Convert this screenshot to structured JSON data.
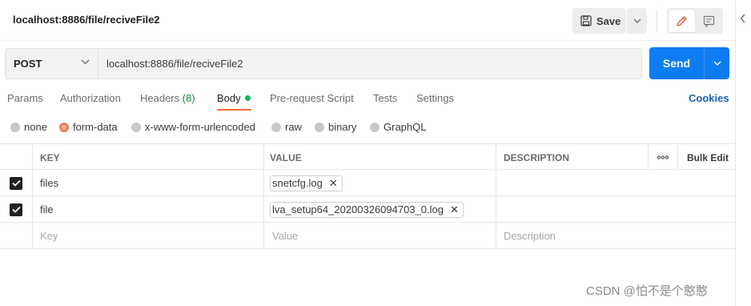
{
  "title_bar": {
    "request_title": "localhost:8886/file/reciveFile2",
    "save_label": "Save"
  },
  "url_bar": {
    "method": "POST",
    "url": "localhost:8886/file/reciveFile2",
    "send_label": "Send"
  },
  "tabs": {
    "params": "Params",
    "authorization": "Authorization",
    "headers_label": "Headers",
    "headers_count": "(8)",
    "body": "Body",
    "pre_request": "Pre-request Script",
    "tests": "Tests",
    "settings": "Settings",
    "active": "Body",
    "cookies": "Cookies"
  },
  "body_types": {
    "options": [
      "none",
      "form-data",
      "x-www-form-urlencoded",
      "raw",
      "binary",
      "GraphQL"
    ],
    "selected": "form-data"
  },
  "table": {
    "headers": {
      "key": "KEY",
      "value": "VALUE",
      "description": "DESCRIPTION",
      "more": "ooo",
      "bulk_edit": "Bulk Edit"
    },
    "rows": [
      {
        "checked": true,
        "key": "files",
        "value": "snetcfg.log",
        "description": ""
      },
      {
        "checked": true,
        "key": "file",
        "value": "lva_setup64_20200326094703_0.log",
        "description": ""
      }
    ],
    "placeholders": {
      "key": "Key",
      "value": "Value",
      "description": "Description"
    }
  },
  "watermark": "CSDN @怕不是个憨憨",
  "colors": {
    "accent_orange": "#ff6c37",
    "send_blue": "#0d7cf2",
    "cookies_blue": "#1a5fb4",
    "headers_count_green": "#1b8a3e",
    "body_dot_green": "#0cbb52"
  },
  "icons": {
    "save": "floppy-disk-icon",
    "edit": "pencil-icon",
    "docs": "comment-doc-icon",
    "rail": "chevron-left-icon"
  }
}
